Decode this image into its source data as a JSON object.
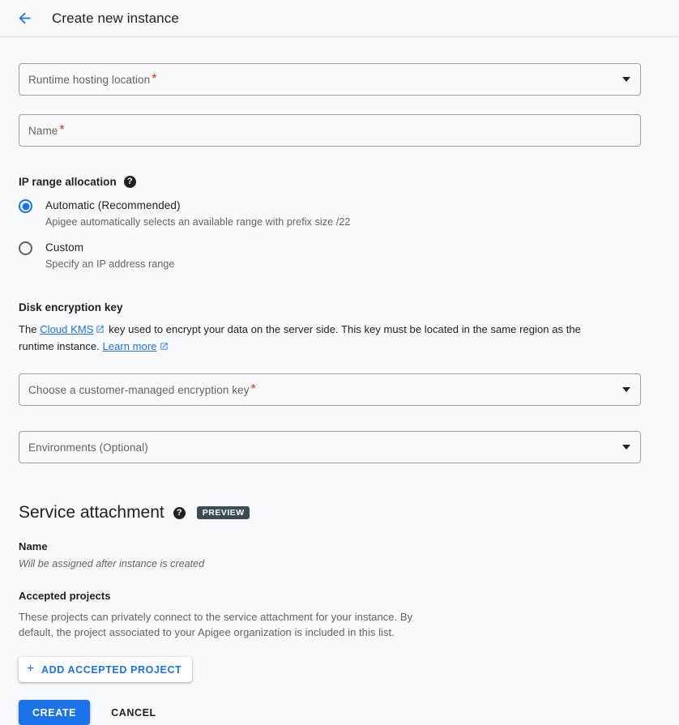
{
  "header": {
    "back_icon": "arrow-left-icon",
    "title": "Create new instance"
  },
  "form": {
    "runtime_location": {
      "label": "Runtime hosting location",
      "required_marker": "*",
      "value": "",
      "caret_icon": "chevron-down-icon"
    },
    "name": {
      "label": "Name",
      "required_marker": "*",
      "value": ""
    },
    "ip_range": {
      "heading": "IP range allocation",
      "help_icon": "help-icon",
      "help_glyph": "?",
      "options": [
        {
          "label": "Automatic (Recommended)",
          "description": "Apigee automatically selects an available range with prefix size /22",
          "selected": true
        },
        {
          "label": "Custom",
          "description": "Specify an IP address range",
          "selected": false
        }
      ]
    },
    "disk_encryption": {
      "heading": "Disk encryption key",
      "desc_part1": "The ",
      "link1": "Cloud KMS",
      "desc_part2": " key used to encrypt your data on the server side. This key must be located in the same region as the runtime instance. ",
      "link2": "Learn more",
      "external_icon": "external-link-icon",
      "cmek_field": {
        "label": "Choose a customer-managed encryption key",
        "required_marker": "*",
        "value": "",
        "caret_icon": "chevron-down-icon"
      }
    },
    "environments": {
      "label": "Environments (Optional)",
      "value": "",
      "caret_icon": "chevron-down-icon"
    }
  },
  "service_attachment": {
    "title": "Service attachment",
    "help_icon": "help-icon",
    "help_glyph": "?",
    "badge": "PREVIEW",
    "name_heading": "Name",
    "name_note": "Will be assigned after instance is created",
    "accepted_heading": "Accepted projects",
    "accepted_desc": "These projects can privately connect to the service attachment for your instance. By default, the project associated to your Apigee organization is included in this list.",
    "add_button": {
      "plus_icon": "plus-icon",
      "label": "ADD ACCEPTED PROJECT"
    }
  },
  "actions": {
    "create_label": "CREATE",
    "cancel_label": "CANCEL"
  },
  "colors": {
    "accent_blue": "#1a73e8",
    "required_red": "#d93025",
    "badge_dark": "#3c4c53",
    "page_bg": "#f8f9fa",
    "border_gray": "#9aa0a6",
    "secondary_text": "#5f6368"
  }
}
